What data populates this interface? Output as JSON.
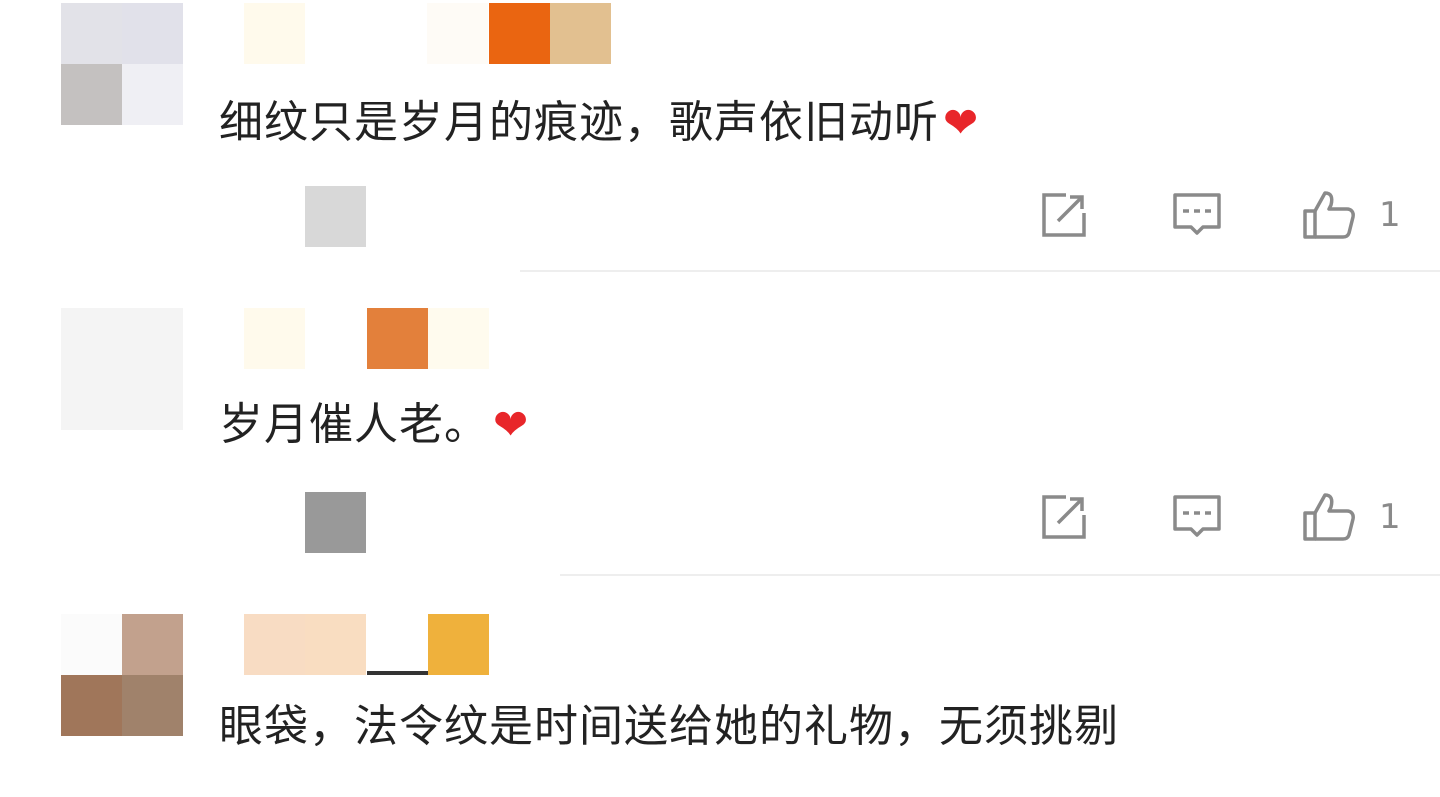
{
  "comments": [
    {
      "text": "细纹只是岁月的痕迹，歌声依旧动听",
      "emoji": "❤",
      "like_count": "1",
      "avatar_colors": [
        "#e2e2e8",
        "#e1e1ea",
        "#c4c1c0",
        "#efeff4"
      ],
      "name_colors": [
        "#fffaec",
        "#ffffff",
        "#fefbf6",
        "#ea6511",
        "#e2c090"
      ],
      "meta_colors": [
        "#d8d8d8",
        "#ffffff"
      ]
    },
    {
      "text": "岁月催人老。",
      "emoji": "❤",
      "like_count": "1",
      "avatar_colors": [
        "#f4f4f4",
        "#f4f4f4",
        "#f4f4f4",
        "#f4f4f4"
      ],
      "name_colors": [
        "#fffaec",
        "#ffffff",
        "#e3803b",
        "#fffbee",
        "#ffffff"
      ],
      "meta_colors": [
        "#999999",
        "#fdfdfd"
      ]
    },
    {
      "text": "眼袋，法令纹是时间送给她的礼物，无须挑剔",
      "emoji": "",
      "like_count": "",
      "avatar_colors": [
        "#fbfbfb",
        "#c2a18d",
        "#a0765a",
        "#a0826b"
      ],
      "name_colors": [
        "#f8dcc3",
        "#f9ddc1",
        "#ffffff",
        "#efb13c",
        "#ffffff"
      ],
      "meta_colors": [
        "#ffffff",
        "#ffffff"
      ]
    }
  ],
  "icons": {
    "share": "share-icon",
    "comment": "comment-icon",
    "like": "thumbs-up-icon",
    "heart": "heart-emoji-icon"
  },
  "colors": {
    "text": "#222222",
    "icon": "#8a8a8a",
    "heart": "#e8262a",
    "divider": "#eeeeee"
  }
}
